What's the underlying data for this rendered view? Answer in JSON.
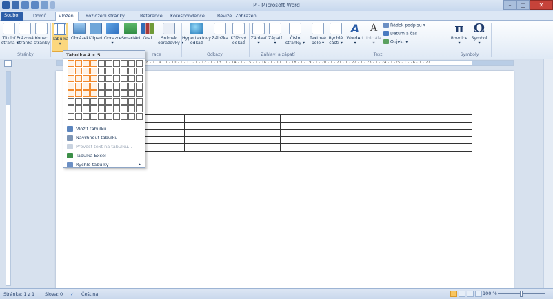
{
  "window": {
    "title": "P - Microsoft Word",
    "min": "–",
    "max": "□",
    "close": "✕"
  },
  "tabs": [
    "Soubor",
    "Domů",
    "Vložení",
    "Rozložení stránky",
    "Reference",
    "Korespondence",
    "Revize",
    "Zobrazení"
  ],
  "ribbon": {
    "pages": [
      "Titulní\nstrana ▾",
      "Prázdná\nstránka",
      "Konec\nstránky"
    ],
    "table": "Tabulka\n▾",
    "illustrations": [
      "Obrázek",
      "Klipart",
      "Obrazce\n▾",
      "SmartArt",
      "Graf",
      "Snímek\nobrazovky ▾"
    ],
    "links": [
      "Hypertextový\nodkaz",
      "Záložka",
      "Křížový\nodkaz"
    ],
    "header": [
      "Záhlaví\n▾",
      "Zápatí\n▾",
      "Číslo\nstránky ▾"
    ],
    "text": [
      "Textové\npole ▾",
      "Rychlé\nčásti ▾",
      "WordArt\n▾",
      "Iniciála\n▾"
    ],
    "text_small": [
      "Řádek podpisu ▾",
      "Datum a čas",
      "Objekt ▾"
    ],
    "symbols": [
      "Rovnice\n▾",
      "Symbol\n▾"
    ],
    "group_labels": {
      "pages": "Stránky",
      "illustrations_partial": "race",
      "links": "Odkazy",
      "header": "Záhlaví a zápatí",
      "text": "Text",
      "symbols": "Symboly"
    }
  },
  "dropdown": {
    "title": "Tabulka 4 × 5",
    "grid": {
      "cols": 10,
      "rows": 8,
      "sel_cols": 4,
      "sel_rows": 5
    },
    "items": [
      {
        "label": "Vložit tabulku...",
        "disabled": false,
        "submenu": false
      },
      {
        "label": "Navrhnout tabulku",
        "disabled": false,
        "submenu": false
      },
      {
        "label": "Převést text na tabulku...",
        "disabled": true,
        "submenu": false
      },
      {
        "label": "Tabulka Excel",
        "disabled": false,
        "submenu": false
      },
      {
        "label": "Rychlé tabulky",
        "disabled": false,
        "submenu": true
      }
    ]
  },
  "ruler_ticks": "· 1 · 4 · 1 · 5 · 1 · 6 · 1 · 7 · 1 · 8 · 1 · 9 · 1 · 10 · 1 · 11 · 1 · 12 · 1 · 13 · 1 · 14 · 1 · 15 · 1 · 16 · 1 · 17 · 1 · 18 · 1 · 19 · 1 · 20 · 1 · 21 · 1 · 22 · 1 · 23 · 1 · 24 · 1 ·25 · 1 · 26 · 1 · 27",
  "doc_table": {
    "rows": 5,
    "cols": 4
  },
  "status": {
    "page": "Stránka: 1 z 1",
    "words": "Slova: 0",
    "language": "Čeština",
    "zoom": "100 %"
  }
}
